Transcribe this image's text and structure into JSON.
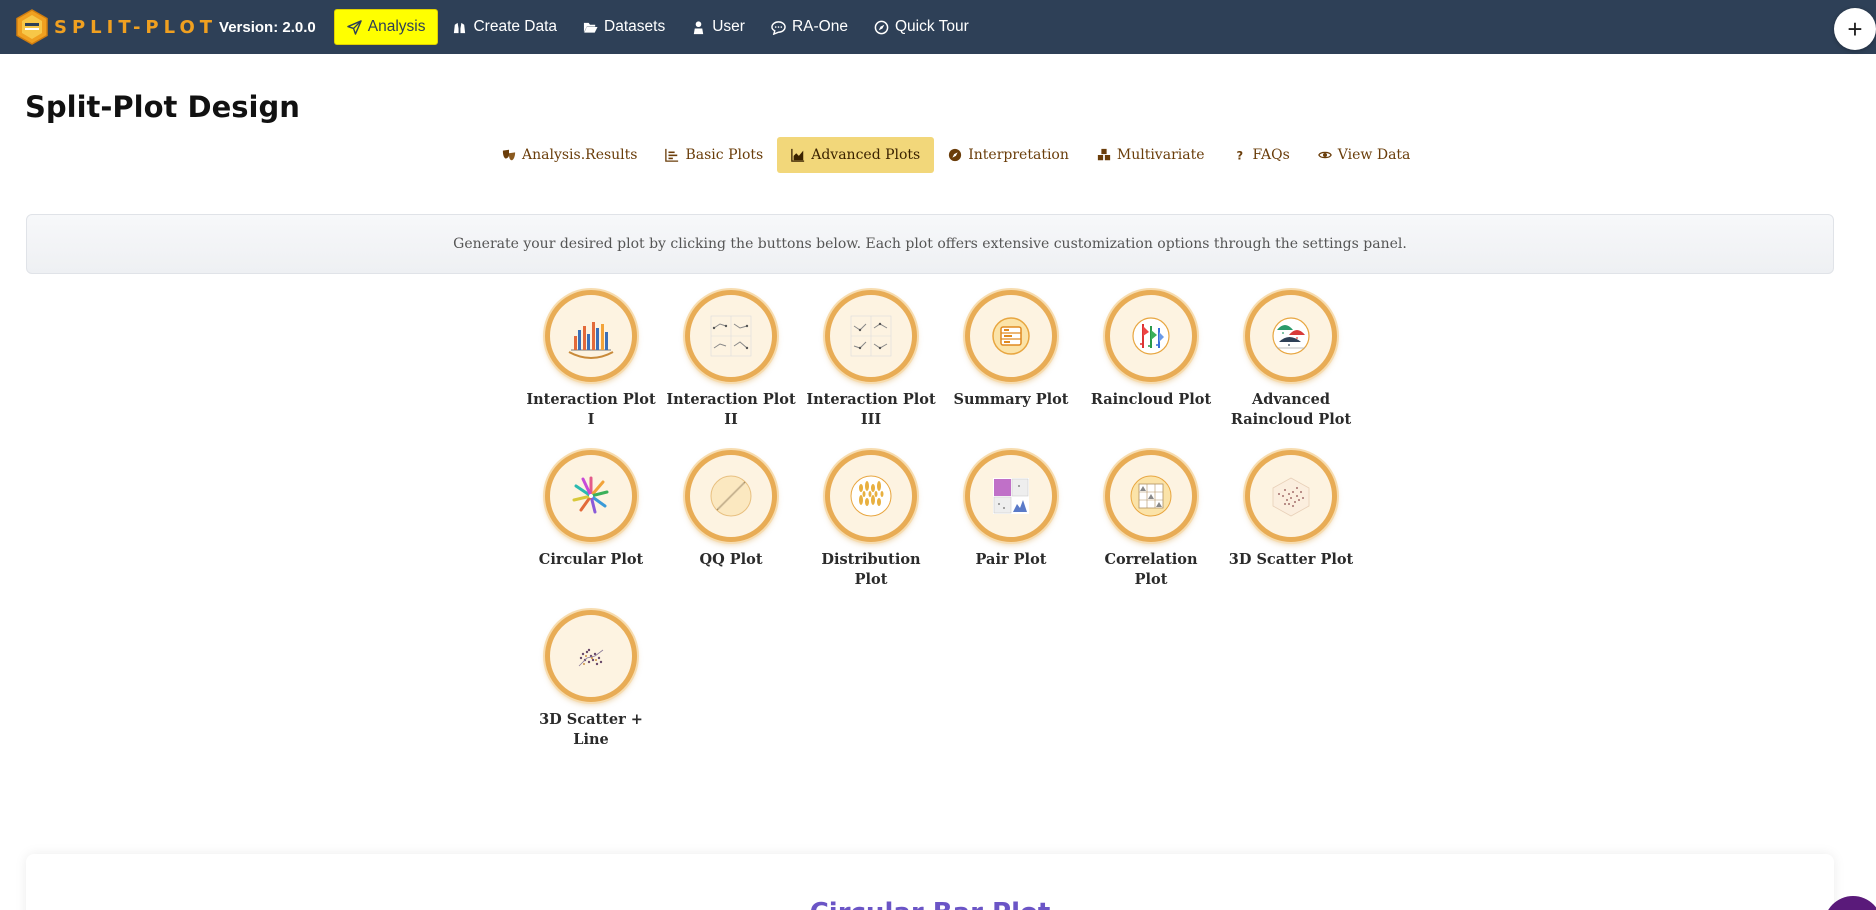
{
  "navbar": {
    "logo_text": "SPLIT-PLOT",
    "version": "Version: 2.0.0",
    "items": [
      {
        "label": "Analysis",
        "icon": "send-icon",
        "active": true
      },
      {
        "label": "Create Data",
        "icon": "binoculars-icon",
        "active": false
      },
      {
        "label": "Datasets",
        "icon": "folder-open-icon",
        "active": false
      },
      {
        "label": "User",
        "icon": "user-icon",
        "active": false
      },
      {
        "label": "RA-One",
        "icon": "chat-icon",
        "active": false
      },
      {
        "label": "Quick Tour",
        "icon": "compass-icon",
        "active": false
      }
    ],
    "plus_label": "+"
  },
  "page": {
    "title": "Split-Plot Design"
  },
  "tabs": [
    {
      "label": "Analysis.Results",
      "icon": "masks-icon",
      "active": false
    },
    {
      "label": "Basic Plots",
      "icon": "bar-chart-icon",
      "active": false
    },
    {
      "label": "Advanced Plots",
      "icon": "area-chart-icon",
      "active": true
    },
    {
      "label": "Interpretation",
      "icon": "compass-icon",
      "active": false
    },
    {
      "label": "Multivariate",
      "icon": "cubes-icon",
      "active": false
    },
    {
      "label": "FAQs",
      "icon": "question-icon",
      "active": false
    },
    {
      "label": "View Data",
      "icon": "eye-icon",
      "active": false
    }
  ],
  "info_text": "Generate your desired plot by clicking the buttons below. Each plot offers extensive customization options through the settings panel.",
  "plots": [
    {
      "label": "Interaction Plot I",
      "icon": "interaction-bars-icon"
    },
    {
      "label": "Interaction Plot II",
      "icon": "interaction-lines-icon"
    },
    {
      "label": "Interaction Plot III",
      "icon": "interaction-lines-icon"
    },
    {
      "label": "Summary Plot",
      "icon": "summary-table-icon"
    },
    {
      "label": "Raincloud Plot",
      "icon": "raincloud-icon"
    },
    {
      "label": "Advanced Raincloud Plot",
      "icon": "advanced-raincloud-icon"
    },
    {
      "label": "Circular Plot",
      "icon": "circular-bars-icon"
    },
    {
      "label": "QQ Plot",
      "icon": "qq-line-icon"
    },
    {
      "label": "Distribution Plot",
      "icon": "distribution-icon"
    },
    {
      "label": "Pair Plot",
      "icon": "pair-grid-icon"
    },
    {
      "label": "Correlation Plot",
      "icon": "correlation-grid-icon"
    },
    {
      "label": "3D Scatter Plot",
      "icon": "scatter-3d-icon"
    },
    {
      "label": "3D Scatter + Line",
      "icon": "scatter-line-3d-icon"
    }
  ],
  "bottom_card": {
    "title": "Circular Bar Plot"
  },
  "colors": {
    "navbar_bg": "#2e4057",
    "logo_orange": "#f0a020",
    "active_nav": "#ffff00",
    "active_tab": "#f2d77a",
    "tab_text": "#6a3d0a",
    "plot_ring": "#e8ac55",
    "bottom_title": "#6b55c6"
  }
}
